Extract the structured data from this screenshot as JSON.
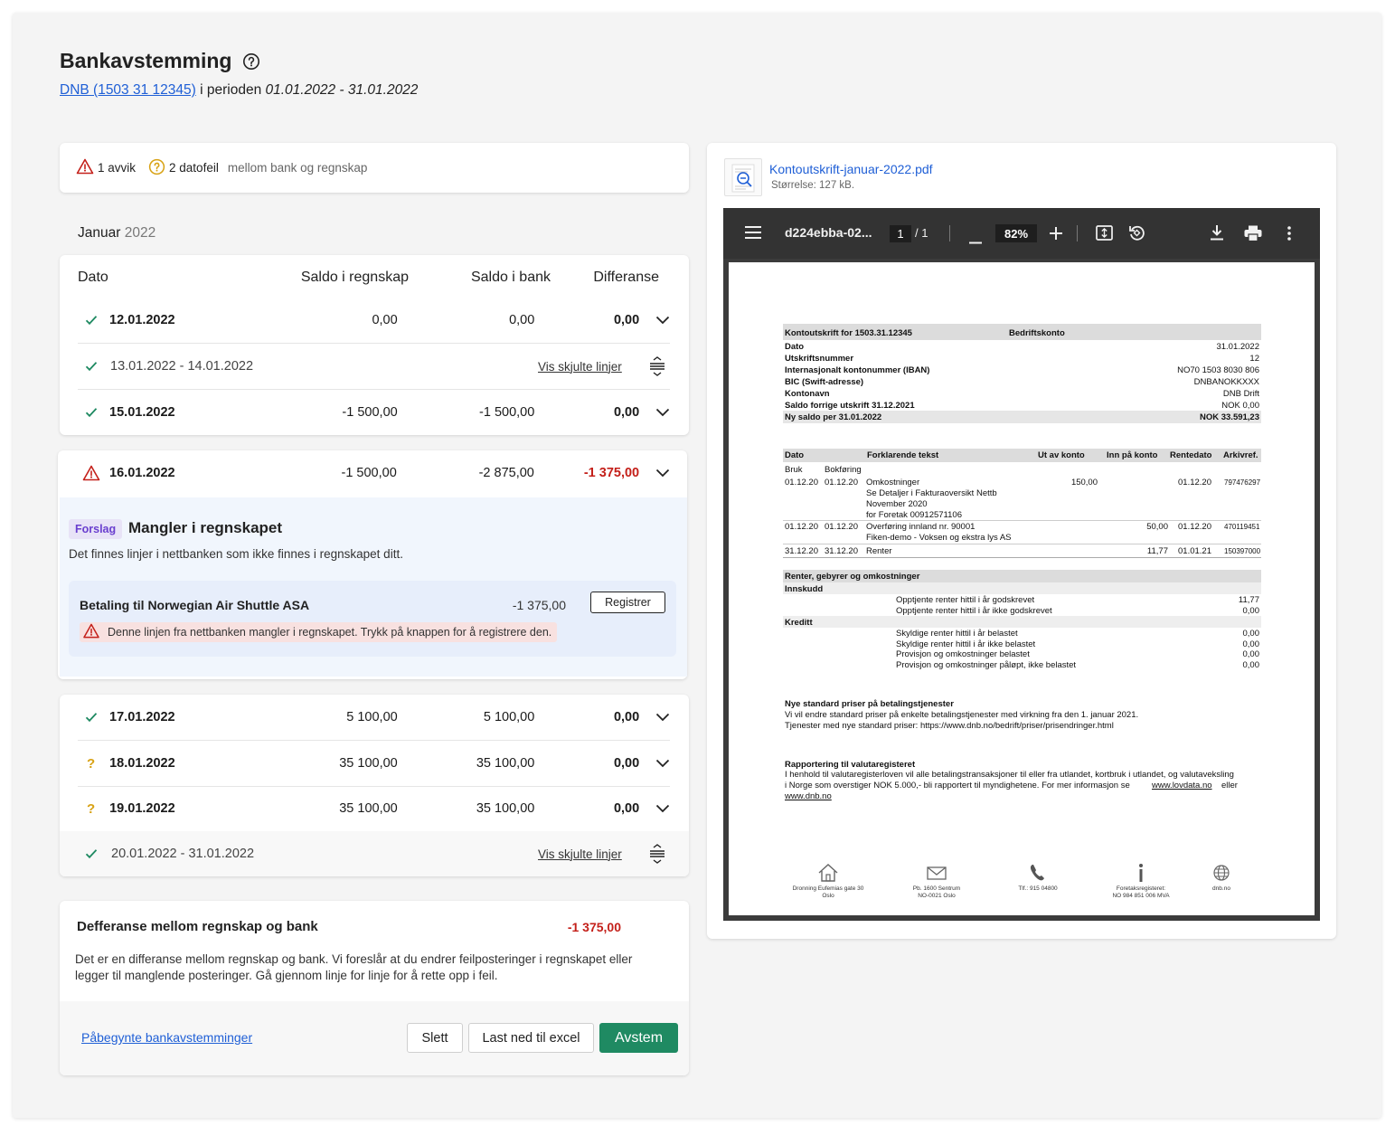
{
  "header": {
    "title": "Bankavstemming",
    "account_link": "DNB (1503 31 12345)",
    "period_prefix": "i perioden",
    "period": "01.01.2022 - 31.01.2022"
  },
  "summary": {
    "deviations": "1 avvik",
    "date_errors": "2 datofeil",
    "suffix": "mellom bank og regnskap"
  },
  "month": {
    "name": "Januar",
    "year": "2022"
  },
  "table": {
    "headers": [
      "Dato",
      "Saldo i regnskap",
      "Saldo i bank",
      "Differanse"
    ],
    "rows": [
      {
        "status": "ok",
        "date": "12.01.2022",
        "ledger": "0,00",
        "bank": "0,00",
        "diff": "0,00"
      },
      {
        "status": "ok",
        "range": "13.01.2022 - 14.01.2022",
        "link": "Vis skjulte linjer"
      },
      {
        "status": "ok",
        "date": "15.01.2022",
        "ledger": "-1 500,00",
        "bank": "-1 500,00",
        "diff": "0,00"
      },
      {
        "status": "warning",
        "date": "16.01.2022",
        "ledger": "-1 500,00",
        "bank": "-2 875,00",
        "diff": "-1 375,00"
      },
      {
        "status": "ok",
        "date": "17.01.2022",
        "ledger": "5 100,00",
        "bank": "5 100,00",
        "diff": "0,00"
      },
      {
        "status": "question",
        "date": "18.01.2022",
        "ledger": "35 100,00",
        "bank": "35 100,00",
        "diff": "0,00"
      },
      {
        "status": "question",
        "date": "19.01.2022",
        "ledger": "35 100,00",
        "bank": "35 100,00",
        "diff": "0,00"
      },
      {
        "status": "ok",
        "range": "20.01.2022 - 31.01.2022",
        "link": "Vis skjulte linjer"
      }
    ]
  },
  "suggestion": {
    "badge": "Forslag",
    "title": "Mangler i regnskapet",
    "description": "Det finnes linjer i nettbanken som ikke finnes i regnskapet ditt.",
    "item_title": "Betaling til Norwegian Air Shuttle ASA",
    "item_amount": "-1 375,00",
    "register_button": "Registrer",
    "warning": "Denne linjen fra nettbanken mangler i regnskapet. Trykk på knappen for å registrere den."
  },
  "difference": {
    "title": "Defferanse mellom regnskap og bank",
    "amount": "-1 375,00",
    "text": "Det er en differanse mellom regnskap og bank. Vi foreslår at du endrer feilposteringer i regnskapet eller legger til manglende posteringer. Gå gjennom linje for linje for å rette opp i feil."
  },
  "footer": {
    "link": "Påbegynte bankavstemminger",
    "delete": "Slett",
    "download": "Last ned til excel",
    "reconcile": "Avstem"
  },
  "attachment": {
    "file_name": "Kontoutskrift-januar-2022.pdf",
    "file_size": "Størrelse: 127 kB."
  },
  "pdf_viewer": {
    "doc_name": "d224ebba-02...",
    "page": "1",
    "page_total": "/  1",
    "zoom": "82%"
  },
  "statement": {
    "title": "Kontoutskrift for 1503.31.12345",
    "account_type": "Bedriftskonto",
    "info": [
      {
        "label": "Dato",
        "value": "31.01.2022"
      },
      {
        "label": "Utskriftsnummer",
        "value": "12"
      },
      {
        "label": "Internasjonalt kontonummer (IBAN)",
        "value": "NO70 1503 8030 806"
      },
      {
        "label": "BIC (Swift-adresse)",
        "value": "DNBANOKKXXX"
      },
      {
        "label": "Kontonavn",
        "value": "DNB Drift"
      },
      {
        "label": "Saldo forrige utskrift 31.12.2021",
        "value": "NOK 0,00"
      },
      {
        "label": "Ny saldo per 31.01.2022",
        "value": "NOK 33.591,23"
      }
    ],
    "tx_headers": [
      "Dato",
      "Forklarende tekst",
      "Ut av konto",
      "Inn på konto",
      "Rentedato",
      "Arkivref."
    ],
    "tx_subheaders": [
      "Bruk",
      "Bokføring"
    ],
    "transactions": [
      {
        "d1": "01.12.20",
        "d2": "01.12.20",
        "text": [
          "Omkostninger",
          "Se Detaljer i Fakturaoversikt Nettb",
          "November 2020",
          "for Foretak 00912571106"
        ],
        "out": "150,00",
        "in": "",
        "rdate": "01.12.20",
        "ref": "797476297"
      },
      {
        "d1": "01.12.20",
        "d2": "01.12.20",
        "text": [
          "Overføring innland nr.  90001",
          "Fiken-demo - Voksen og ekstra lys AS"
        ],
        "out": "",
        "in": "50,00",
        "rdate": "01.12.20",
        "ref": "470119451"
      },
      {
        "d1": "31.12.20",
        "d2": "31.12.20",
        "text": [
          "Renter"
        ],
        "out": "",
        "in": "11,77",
        "rdate": "01.01.21",
        "ref": "150397000"
      }
    ],
    "fees_title": "Renter, gebyrer og omkostninger",
    "deposit_label": "Innskudd",
    "deposit_lines": [
      {
        "label": "Opptjente renter hittil i år godskrevet",
        "value": "11,77"
      },
      {
        "label": "Opptjente renter hittil i år ikke godskrevet",
        "value": "0,00"
      }
    ],
    "credit_label": "Kreditt",
    "credit_lines": [
      {
        "label": "Skyldige renter hittil i år belastet",
        "value": "0,00"
      },
      {
        "label": "Skyldige renter hittil i år ikke belastet",
        "value": "0,00"
      },
      {
        "label": "Provisjon og omkostninger belastet",
        "value": "0,00"
      },
      {
        "label": "Provisjon og omkostninger påløpt, ikke belastet",
        "value": "0,00"
      }
    ],
    "notice1_title": "Nye standard priser på betalingstjenester",
    "notice1_lines": [
      "Vi vil endre standard priser på enkelte betalingstjenester med virkning fra den 1. januar 2021.",
      "Tjenester med nye standard priser: https://www.dnb.no/bedrift/priser/prisendringer.html"
    ],
    "notice2_title": "Rapportering til valutaregisteret",
    "notice2_lines": [
      "I henhold til valutaregisterloven vil alle betalingstransaksjoner til eller fra utlandet, kortbruk i utlandet, og valutaveksling",
      "i Norge som overstiger NOK 5.000,- bli rapportert til myndighetene. For mer informasjon se"
    ],
    "notice2_link1": "www.lovdata.no",
    "notice2_eller": "eller",
    "notice2_link2": "www.dnb.no",
    "footer_items": [
      {
        "icon": "house-icon",
        "lines": [
          "Dronning Eufemias gate 30",
          "Oslo"
        ]
      },
      {
        "icon": "envelope-icon",
        "lines": [
          "Pb. 1600 Sentrum",
          "NO-0021 Oslo"
        ]
      },
      {
        "icon": "phone-icon",
        "lines": [
          "Tlf.: 915 04800"
        ]
      },
      {
        "icon": "info-icon",
        "lines": [
          "Foretaksregisteret:",
          "NO 984 851 006 MVA"
        ]
      },
      {
        "icon": "globe-icon",
        "lines": [
          "dnb.no"
        ]
      }
    ]
  }
}
